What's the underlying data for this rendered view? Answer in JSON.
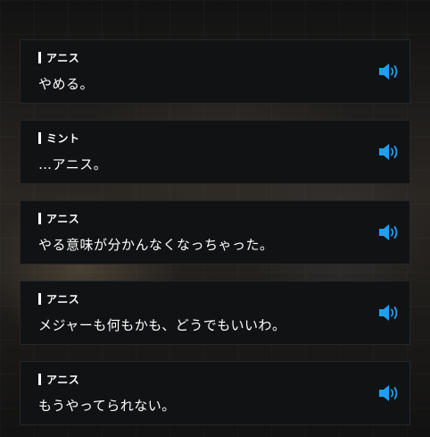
{
  "accent_color": "#1ea0f0",
  "voice_icon": "speaker-icon",
  "entries": [
    {
      "speaker": "アニス",
      "text": "やめる。"
    },
    {
      "speaker": "ミント",
      "text": "…アニス。"
    },
    {
      "speaker": "アニス",
      "text": "やる意味が分かんなくなっちゃった。"
    },
    {
      "speaker": "アニス",
      "text": "メジャーも何もかも、どうでもいいわ。"
    },
    {
      "speaker": "アニス",
      "text": "もうやってられない。"
    }
  ]
}
